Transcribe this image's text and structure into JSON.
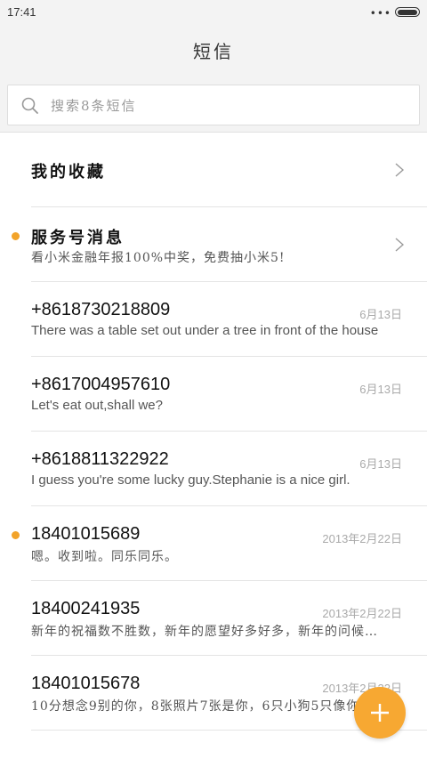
{
  "status": {
    "time": "17:41",
    "dots": "•••"
  },
  "header": {
    "title": "短信"
  },
  "search": {
    "placeholder": "搜索8条短信"
  },
  "favorites": {
    "label": "我的收藏"
  },
  "service": {
    "name": "服务号消息",
    "snippet": "看小米金融年报100%中奖，免费抽小米5!",
    "unread": true
  },
  "conversations": [
    {
      "name": "+8618730218809",
      "snippet": "There was a table set out under a tree in front of the house",
      "date": "6月13日",
      "unread": false
    },
    {
      "name": "+8617004957610",
      "snippet": "Let's eat out,shall we?",
      "date": "6月13日",
      "unread": false
    },
    {
      "name": "+8618811322922",
      "snippet": "I guess you're some lucky guy.Stephanie is a nice girl.",
      "date": "6月13日",
      "unread": false
    },
    {
      "name": "18401015689",
      "snippet": "嗯。收到啦。同乐同乐。",
      "date": "2013年2月22日",
      "unread": true
    },
    {
      "name": "18400241935",
      "snippet": "新年的祝福数不胜数，新年的愿望好多好多，新年的问候…",
      "date": "2013年2月22日",
      "unread": false
    },
    {
      "name": "18401015678",
      "snippet": "10分想念9别的你，8张照片7张是你，6只小狗5只像你",
      "date": "2013年2月22日",
      "unread": false
    }
  ],
  "colors": {
    "accent": "#f7a832",
    "unread_dot": "#f2a32a",
    "background": "#f3f3f3"
  },
  "icons": {
    "search": "search-icon",
    "chevron": "chevron-right-icon",
    "compose": "plus-icon"
  }
}
